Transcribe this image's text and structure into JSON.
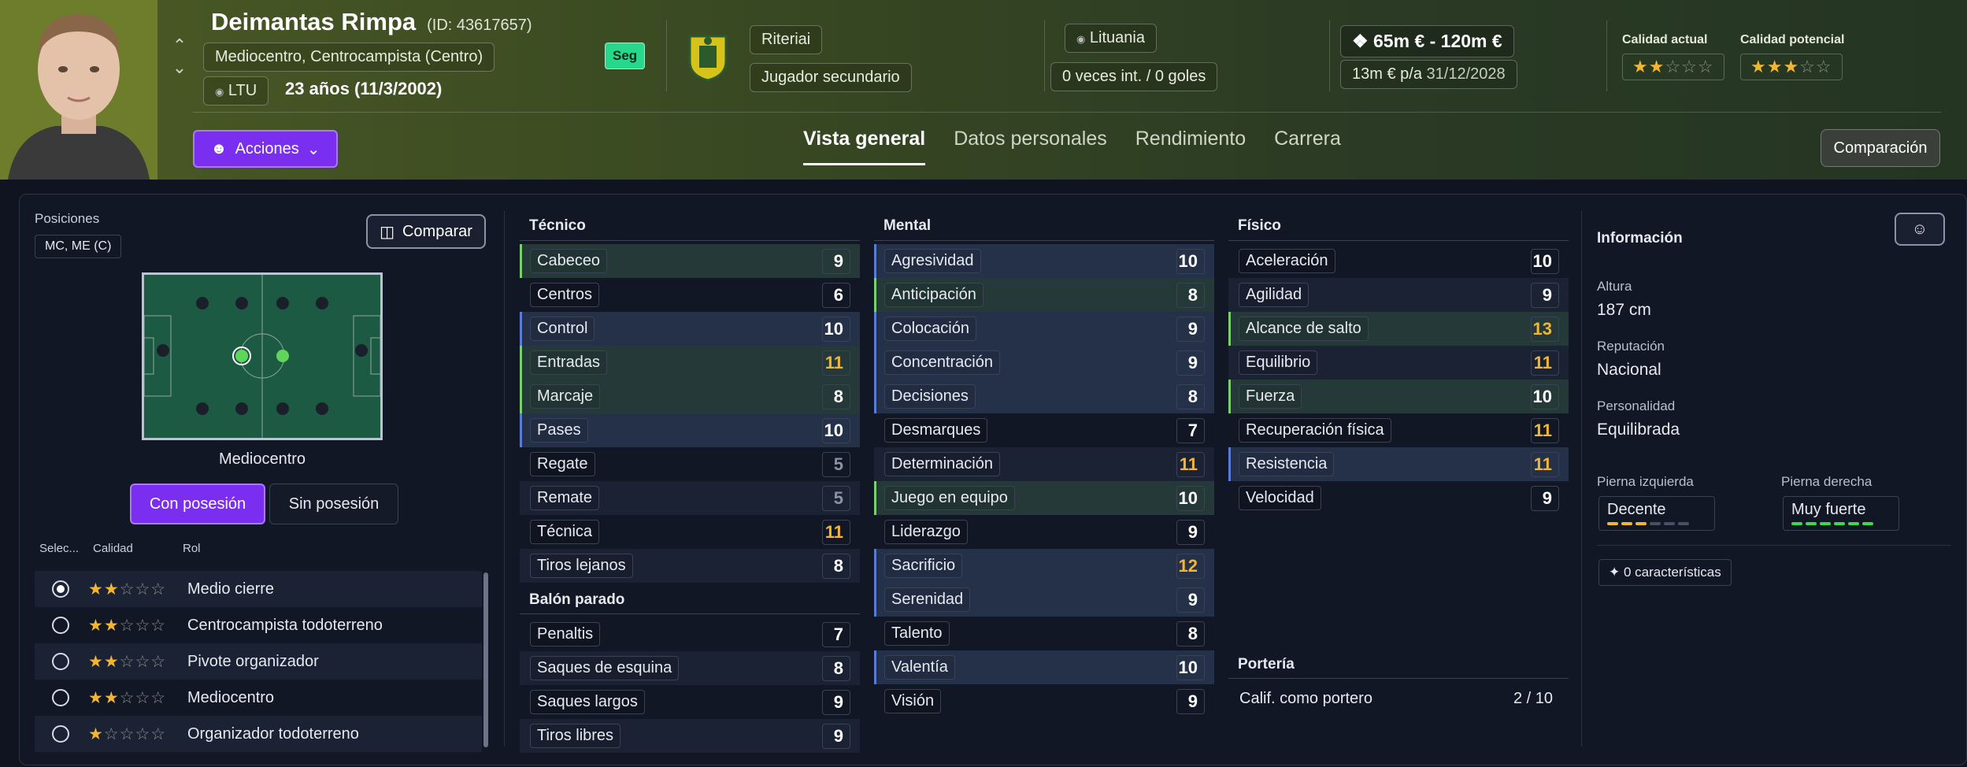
{
  "header": {
    "name": "Deimantas Rimpa",
    "id": "(ID: 43617657)",
    "position": "Mediocentro, Centrocampista (Centro)",
    "nationality_code": "LTU",
    "age": "23 años (11/3/2002)",
    "squad_badge": "Seg",
    "club": "Riteriai",
    "squad_role": "Jugador secundario",
    "country": "Lituania",
    "caps": "0 veces int. / 0 goles",
    "value": "65m € - 120m €",
    "wage": "13m € p/a",
    "contract_end": "31/12/2028",
    "current_ability_label": "Calidad actual",
    "potential_ability_label": "Calidad potencial",
    "current_ability_stars": 2,
    "potential_ability_stars": 3,
    "acciones_label": "Acciones",
    "comparacion_label": "Comparación",
    "tabs": [
      "Vista general",
      "Datos personales",
      "Rendimiento",
      "Carrera"
    ]
  },
  "positions": {
    "label": "Posiciones",
    "value": "MC, ME (C)",
    "compare_label": "Comparar",
    "pitch_label": "Mediocentro",
    "with_ball": "Con posesión",
    "without_ball": "Sin posesión",
    "col_select": "Selec...",
    "col_quality": "Calidad",
    "col_role": "Rol",
    "roles": [
      {
        "name": "Medio cierre",
        "stars": 2,
        "selected": true
      },
      {
        "name": "Centrocampista todoterreno",
        "stars": 2,
        "selected": false
      },
      {
        "name": "Pivote organizador",
        "stars": 2,
        "selected": false
      },
      {
        "name": "Mediocentro",
        "stars": 2,
        "selected": false
      },
      {
        "name": "Organizador todoterreno",
        "stars": 1.5,
        "selected": false
      }
    ]
  },
  "tecnico": {
    "title": "Técnico",
    "rows": [
      {
        "name": "Cabeceo",
        "value": "9"
      },
      {
        "name": "Centros",
        "value": "6"
      },
      {
        "name": "Control",
        "value": "10"
      },
      {
        "name": "Entradas",
        "value": "11"
      },
      {
        "name": "Marcaje",
        "value": "8"
      },
      {
        "name": "Pases",
        "value": "10"
      },
      {
        "name": "Regate",
        "value": "5"
      },
      {
        "name": "Remate",
        "value": "5"
      },
      {
        "name": "Técnica",
        "value": "11"
      },
      {
        "name": "Tiros lejanos",
        "value": "8"
      }
    ]
  },
  "balon_parado": {
    "title": "Balón parado",
    "rows": [
      {
        "name": "Penaltis",
        "value": "7"
      },
      {
        "name": "Saques de esquina",
        "value": "8"
      },
      {
        "name": "Saques largos",
        "value": "9"
      },
      {
        "name": "Tiros libres",
        "value": "9"
      }
    ]
  },
  "mental": {
    "title": "Mental",
    "rows": [
      {
        "name": "Agresividad",
        "value": "10"
      },
      {
        "name": "Anticipación",
        "value": "8"
      },
      {
        "name": "Colocación",
        "value": "9"
      },
      {
        "name": "Concentración",
        "value": "9"
      },
      {
        "name": "Decisiones",
        "value": "8"
      },
      {
        "name": "Desmarques",
        "value": "7"
      },
      {
        "name": "Determinación",
        "value": "11"
      },
      {
        "name": "Juego en equipo",
        "value": "10"
      },
      {
        "name": "Liderazgo",
        "value": "9"
      },
      {
        "name": "Sacrificio",
        "value": "12"
      },
      {
        "name": "Serenidad",
        "value": "9"
      },
      {
        "name": "Talento",
        "value": "8"
      },
      {
        "name": "Valentía",
        "value": "10"
      },
      {
        "name": "Visión",
        "value": "9"
      }
    ]
  },
  "fisico": {
    "title": "Físico",
    "rows": [
      {
        "name": "Aceleración",
        "value": "10"
      },
      {
        "name": "Agilidad",
        "value": "9"
      },
      {
        "name": "Alcance de salto",
        "value": "13"
      },
      {
        "name": "Equilibrio",
        "value": "11"
      },
      {
        "name": "Fuerza",
        "value": "10"
      },
      {
        "name": "Recuperación física",
        "value": "11"
      },
      {
        "name": "Resistencia",
        "value": "11"
      },
      {
        "name": "Velocidad",
        "value": "9"
      }
    ]
  },
  "porteria": {
    "title": "Portería",
    "gk_label": "Calif. como portero",
    "gk_value": "2 / 10"
  },
  "info": {
    "title": "Información",
    "height_label": "Altura",
    "height": "187 cm",
    "reputation_label": "Reputación",
    "reputation": "Nacional",
    "personality_label": "Personalidad",
    "personality": "Equilibrada",
    "left_foot_label": "Pierna izquierda",
    "left_foot": "Decente",
    "left_foot_level": 3,
    "right_foot_label": "Pierna derecha",
    "right_foot": "Muy fuerte",
    "right_foot_level": 6,
    "traits": "0 características"
  },
  "colors": {
    "accent_purple": "#7a2ff0",
    "gold_value": "#f2b632",
    "green_highlight": "#7bcf6e",
    "blue_highlight": "#5b7bd4"
  }
}
